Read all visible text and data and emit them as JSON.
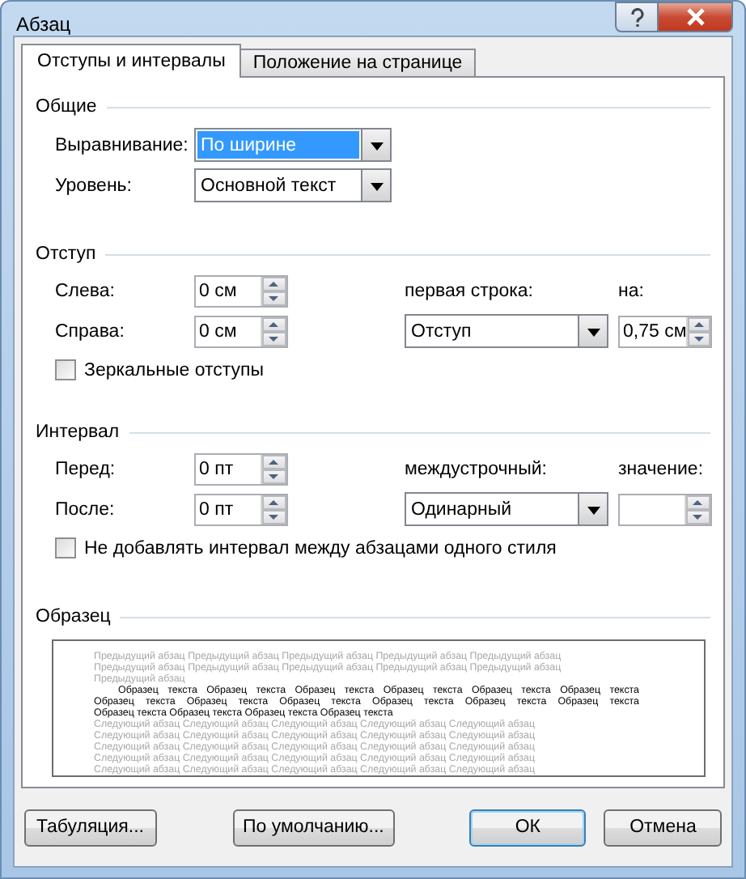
{
  "window": {
    "title": "Абзац"
  },
  "tabs": [
    {
      "label": "Отступы и интервалы",
      "selected": true
    },
    {
      "label": "Положение на странице",
      "selected": false
    }
  ],
  "general": {
    "title": "Общие",
    "alignment": {
      "label": "Выравнивание:",
      "value": "По ширине",
      "focused": true
    },
    "level": {
      "label": "Уровень:",
      "value": "Основной текст",
      "focused": false
    }
  },
  "indent": {
    "title": "Отступ",
    "left": {
      "label": "Слева:",
      "value": "0 см"
    },
    "right": {
      "label": "Справа:",
      "value": "0 см"
    },
    "first_line": {
      "label": "первая строка:",
      "value": "Отступ"
    },
    "by": {
      "label": "на:",
      "value": "0,75 см"
    },
    "mirror": {
      "label": "Зеркальные отступы",
      "checked": false
    }
  },
  "spacing": {
    "title": "Интервал",
    "before": {
      "label": "Перед:",
      "value": "0 пт"
    },
    "after": {
      "label": "После:",
      "value": "0 пт"
    },
    "line_spacing": {
      "label": "междустрочный:",
      "value": "Одинарный"
    },
    "at": {
      "label": "значение:"
    },
    "no_space": {
      "label": "Не добавлять интервал между абзацами одного стиля",
      "checked": false
    }
  },
  "preview": {
    "title": "Образец",
    "previous_lines": [
      "Предыдущий абзац Предыдущий абзац Предыдущий абзац Предыдущий абзац Предыдущий абзац",
      "Предыдущий абзац Предыдущий абзац Предыдущий абзац Предыдущий абзац Предыдущий абзац",
      "Предыдущий абзац"
    ],
    "sample_lines": [
      "Образец текста Образец текста Образец текста Образец текста Образец текста Образец текста",
      "Образец текста Образец текста Образец текста Образец текста Образец текста Образец текста",
      "Образец текста Образец текста Образец текста Образец текста"
    ],
    "next_lines": [
      "Следующий абзац Следующий абзац Следующий абзац Следующий абзац Следующий абзац",
      "Следующий абзац Следующий абзац Следующий абзац Следующий абзац Следующий абзац",
      "Следующий абзац Следующий абзац Следующий абзац Следующий абзац Следующий абзац",
      "Следующий абзац Следующий абзац Следующий абзац Следующий абзац Следующий абзац",
      "Следующий абзац Следующий абзац Следующий абзац Следующий абзац Следующий абзац"
    ]
  },
  "buttons": [
    {
      "label": "Табуляция...",
      "default": false
    },
    {
      "label": "По умолчанию...",
      "default": false
    },
    {
      "label": "ОК",
      "default": true
    },
    {
      "label": "Отмена",
      "default": false
    }
  ]
}
